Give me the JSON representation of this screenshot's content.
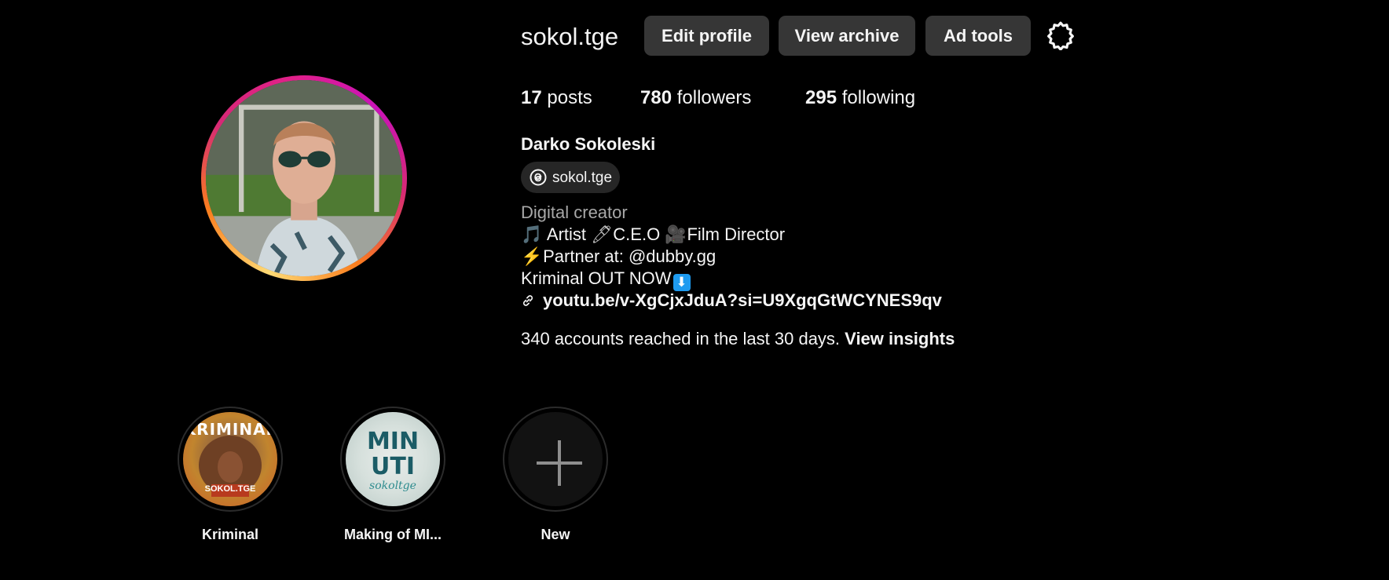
{
  "profile": {
    "username": "sokol.tge",
    "full_name": "Darko Sokoleski",
    "threads_handle": "sokol.tge",
    "category": "Digital creator"
  },
  "header": {
    "edit_profile_label": "Edit profile",
    "view_archive_label": "View archive",
    "ad_tools_label": "Ad tools",
    "settings_icon": "gear-icon"
  },
  "stats": {
    "posts_count": "17",
    "posts_label": "posts",
    "followers_count": "780",
    "followers_label": "followers",
    "following_count": "295",
    "following_label": "following"
  },
  "bio": {
    "line1_note": "🎵",
    "line1_a": "Artist",
    "line1_pen": "🖊",
    "line1_b": "C.E.O",
    "line1_camera": "🎥",
    "line1_c": "Film Director",
    "line2_bolt": "⚡",
    "line2_text": "Partner at: @dubby.gg",
    "line3_text": "Kriminal OUT NOW",
    "line3_arrow": "⬇",
    "link_text": "youtu.be/v-XgCjxJduA?si=U9XgqGtWCYNES9qv"
  },
  "insights": {
    "text": "340 accounts reached in the last 30 days.",
    "link_label": "View insights"
  },
  "highlights": [
    {
      "label": "Kriminal",
      "cover_title": "KRIMINAL",
      "cover_sub": "SOKOL.TGE"
    },
    {
      "label": "Making of MI...",
      "cover_title": "MIN UTI",
      "cover_sub": "sokoltge"
    },
    {
      "label": "New",
      "icon": "plus-icon"
    }
  ],
  "colors": {
    "background": "#000000",
    "button_bg": "#363636",
    "pill_bg": "#262626",
    "muted_text": "#a8a8a8",
    "ring_gradient": [
      "#feda75",
      "#fa7e1e",
      "#d62976",
      "#c913b9"
    ]
  }
}
